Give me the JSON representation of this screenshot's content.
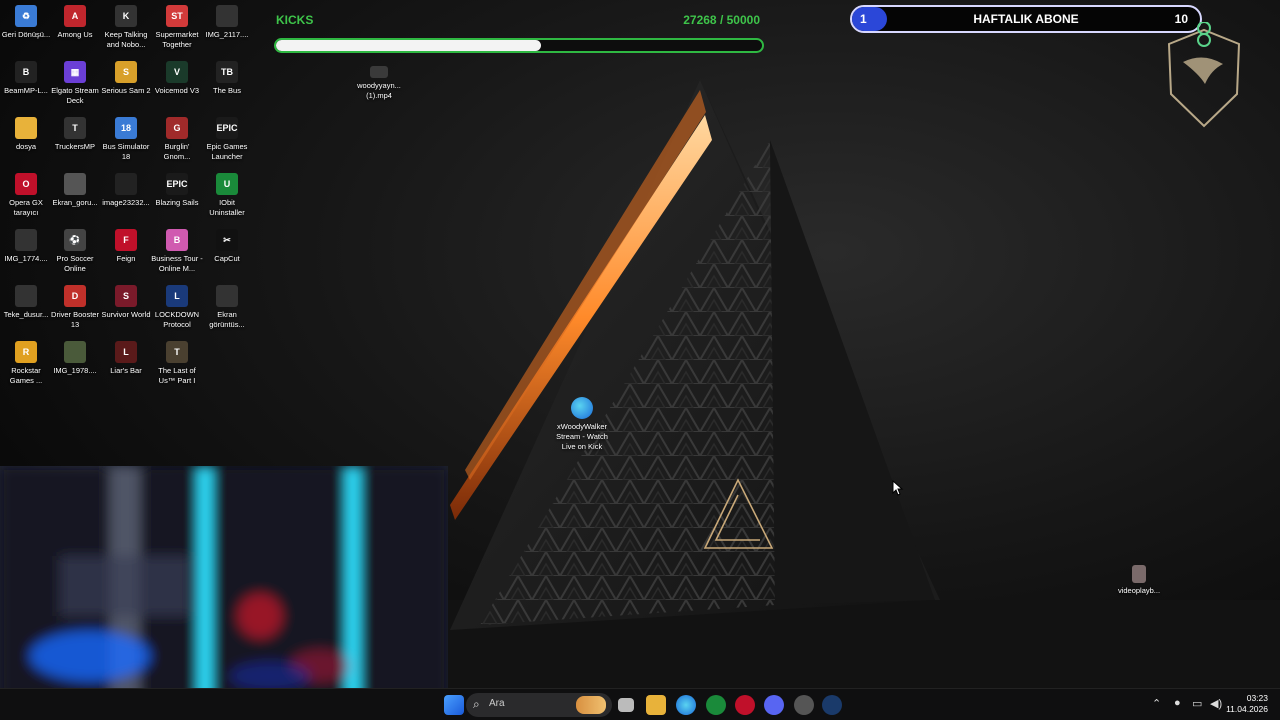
{
  "desktop_icons": [
    {
      "label": "Geri Dönüşü...",
      "icon": "recycle-bin-icon",
      "color": "#3a7bd5",
      "glyph": "♻"
    },
    {
      "label": "Among Us",
      "icon": "among-us-icon",
      "color": "#c0262d",
      "glyph": "A"
    },
    {
      "label": "Keep Talking and Nobo...",
      "icon": "keep-talking-icon",
      "color": "#333333",
      "glyph": "K"
    },
    {
      "label": "Supermarket Together",
      "icon": "supermarket-icon",
      "color": "#d23a3a",
      "glyph": "ST"
    },
    {
      "label": "IMG_2117....",
      "icon": "image-file-icon",
      "color": "#333333",
      "glyph": ""
    },
    {
      "label": "BeamMP-L...",
      "icon": "beammp-icon",
      "color": "#222222",
      "glyph": "B"
    },
    {
      "label": "Elgato Stream Deck",
      "icon": "stream-deck-icon",
      "color": "#6b3fd6",
      "glyph": "▦"
    },
    {
      "label": "Serious Sam 2",
      "icon": "serious-sam-icon",
      "color": "#d8a02a",
      "glyph": "S"
    },
    {
      "label": "Voicemod V3",
      "icon": "voicemod-icon",
      "color": "#1a3a2a",
      "glyph": "V"
    },
    {
      "label": "The Bus",
      "icon": "the-bus-icon",
      "color": "#222222",
      "glyph": "TB"
    },
    {
      "label": "dosya",
      "icon": "folder-icon",
      "color": "#e8b23a",
      "glyph": ""
    },
    {
      "label": "TruckersMP",
      "icon": "truckersmp-icon",
      "color": "#333333",
      "glyph": "T"
    },
    {
      "label": "Bus Simulator 18",
      "icon": "bus-simulator-icon",
      "color": "#3a7bd5",
      "glyph": "18"
    },
    {
      "label": "Burglin' Gnom...",
      "icon": "burglin-gnomes-icon",
      "color": "#a02a2a",
      "glyph": "G"
    },
    {
      "label": "Epic Games Launcher",
      "icon": "epic-games-icon",
      "color": "#1a1a1a",
      "glyph": "EPIC"
    },
    {
      "label": "Opera GX tarayıcı",
      "icon": "opera-gx-icon",
      "color": "#c0102a",
      "glyph": "O"
    },
    {
      "label": "Ekran_goru...",
      "icon": "screenshot-file-icon",
      "color": "#555555",
      "glyph": ""
    },
    {
      "label": "image23232...",
      "icon": "image-file-icon",
      "color": "#222222",
      "glyph": ""
    },
    {
      "label": "Blazing Sails",
      "icon": "epic-games-icon",
      "color": "#1a1a1a",
      "glyph": "EPIC"
    },
    {
      "label": "IObit Uninstaller",
      "icon": "iobit-icon",
      "color": "#1a8a3a",
      "glyph": "U"
    },
    {
      "label": "IMG_1774....",
      "icon": "image-file-icon",
      "color": "#333333",
      "glyph": ""
    },
    {
      "label": "Pro Soccer Online",
      "icon": "soccer-icon",
      "color": "#444444",
      "glyph": "⚽"
    },
    {
      "label": "Feign",
      "icon": "feign-icon",
      "color": "#c0102a",
      "glyph": "F"
    },
    {
      "label": "Business Tour - Online M...",
      "icon": "business-tour-icon",
      "color": "#d05ab0",
      "glyph": "B"
    },
    {
      "label": "CapCut",
      "icon": "capcut-icon",
      "color": "#111111",
      "glyph": "✂"
    },
    {
      "label": "Teke_dusur...",
      "icon": "document-file-icon",
      "color": "#333333",
      "glyph": ""
    },
    {
      "label": "Driver Booster 13",
      "icon": "driver-booster-icon",
      "color": "#c0302a",
      "glyph": "D"
    },
    {
      "label": "Survivor World",
      "icon": "survivor-world-icon",
      "color": "#7a1a2a",
      "glyph": "S"
    },
    {
      "label": "LOCKDOWN Protocol",
      "icon": "lockdown-icon",
      "color": "#1a3a7a",
      "glyph": "L"
    },
    {
      "label": "Ekran görüntüs...",
      "icon": "screenshot-file-icon",
      "color": "#333333",
      "glyph": ""
    },
    {
      "label": "Rockstar Games ...",
      "icon": "rockstar-icon",
      "color": "#e0a020",
      "glyph": "R"
    },
    {
      "label": "IMG_1978....",
      "icon": "image-file-icon",
      "color": "#4a5a3a",
      "glyph": ""
    },
    {
      "label": "Liar's Bar",
      "icon": "liars-bar-icon",
      "color": "#5a1a1a",
      "glyph": "L"
    },
    {
      "label": "The Last of Us™ Part I",
      "icon": "last-of-us-icon",
      "color": "#4a4030",
      "glyph": "T"
    }
  ],
  "desktop_files": [
    {
      "label": "woodyyayn... (1).mp4",
      "icon": "video-file-icon"
    },
    {
      "label": "xWoodyWalker Stream - Watch Live on Kick",
      "icon": "edge-shortcut-icon"
    },
    {
      "label": "videoplayb...",
      "icon": "video-thumbnail-icon"
    }
  ],
  "kicks_goal": {
    "title": "KICKS",
    "current": "27268",
    "separator": " / ",
    "target": "50000",
    "progress": 0.545,
    "color": "#3ec44a"
  },
  "sub_goal": {
    "current": "1",
    "label": "HAFTALIK ABONE",
    "target": "10",
    "progress": 0.1,
    "color": "#2b47d8"
  },
  "taskbar": {
    "search_placeholder": "Ara",
    "time": "03:23",
    "date": "11.04.2026",
    "pinned": [
      "start-icon",
      "search-icon",
      "widgets-icon",
      "task-view-icon",
      "file-explorer-icon",
      "edge-icon",
      "iobit-icon",
      "opera-gx-icon",
      "discord-icon",
      "steam-helper-icon",
      "steam-icon"
    ]
  },
  "colors": {
    "accent_green": "#3ec44a",
    "accent_blue": "#2b47d8",
    "wallpaper_glow": "#ff8a2a"
  }
}
